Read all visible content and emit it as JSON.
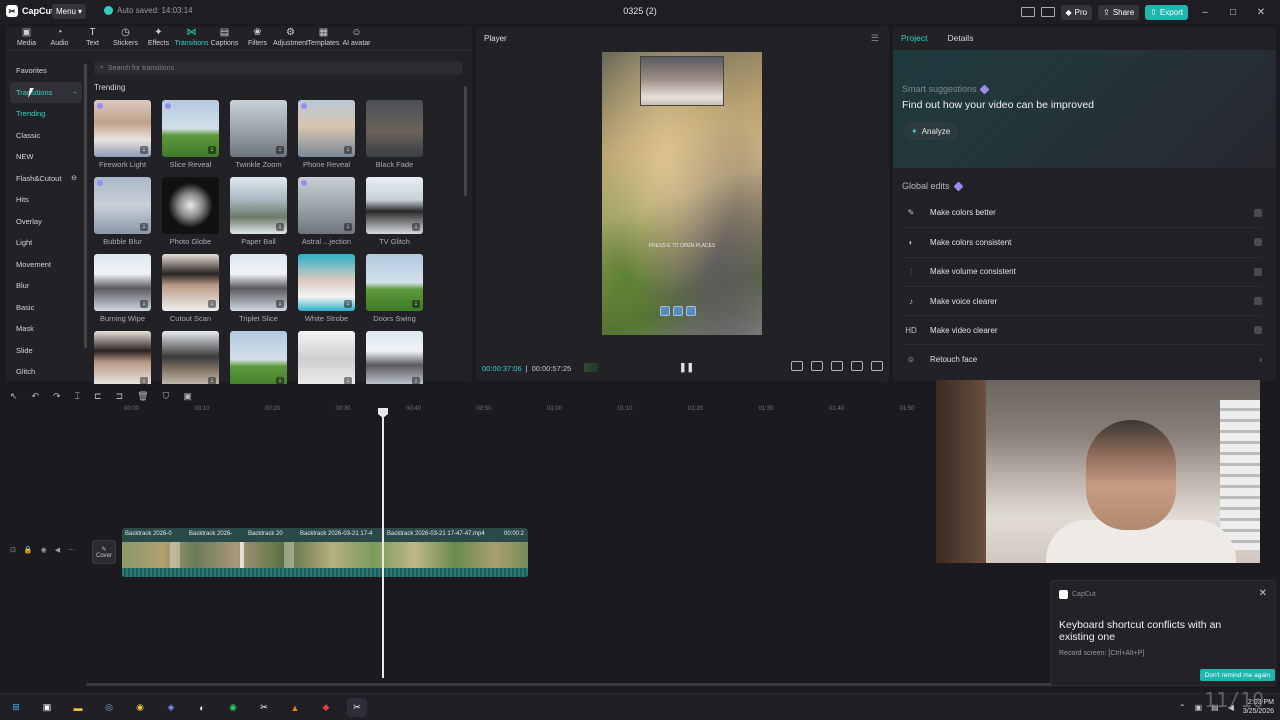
{
  "app": {
    "name": "CapCut",
    "menu": "Menu",
    "autosave": "Auto saved: 14:03:14",
    "project": "0325 (2)"
  },
  "titlebar": {
    "pro": "Pro",
    "share": "Share",
    "export": "Export"
  },
  "toolbar": [
    {
      "label": "Media",
      "icon": "media-icon",
      "glyph": "▣"
    },
    {
      "label": "Audio",
      "icon": "audio-icon",
      "glyph": "◔"
    },
    {
      "label": "Text",
      "icon": "text-icon",
      "glyph": "T"
    },
    {
      "label": "Stickers",
      "icon": "sticker-icon",
      "glyph": "◷"
    },
    {
      "label": "Effects",
      "icon": "effects-icon",
      "glyph": "✦"
    },
    {
      "label": "Transitions",
      "icon": "transitions-icon",
      "glyph": "⋈"
    },
    {
      "label": "Captions",
      "icon": "captions-icon",
      "glyph": "▤"
    },
    {
      "label": "Filters",
      "icon": "filters-icon",
      "glyph": "❀"
    },
    {
      "label": "Adjustment",
      "icon": "adjustment-icon",
      "glyph": "⚙"
    },
    {
      "label": "Templates",
      "icon": "templates-icon",
      "glyph": "▦"
    },
    {
      "label": "AI avatar",
      "icon": "ai-avatar-icon",
      "glyph": "☺"
    }
  ],
  "categories": [
    "Favorites",
    "Transitions",
    "Trending",
    "Classic",
    "NEW",
    "Flash&Cutout",
    "Hits",
    "Overlay",
    "Light",
    "Movement",
    "Blur",
    "Basic",
    "Mask",
    "Slide",
    "Glitch"
  ],
  "search": {
    "placeholder": "Search for transitions"
  },
  "section": "Trending",
  "transitions": [
    {
      "label": "Firework Light",
      "style": "t-portrait"
    },
    {
      "label": "Slice Reveal",
      "style": "t-table"
    },
    {
      "label": "Twinkle Zoom",
      "style": "t-car"
    },
    {
      "label": "Phone Reveal",
      "style": "t-tower"
    },
    {
      "label": "Black Fade",
      "style": "t-dark"
    },
    {
      "label": "Bubble Blur",
      "style": "t-blur"
    },
    {
      "label": "Photo Globe",
      "style": "t-globe"
    },
    {
      "label": "Paper Ball",
      "style": "t-paper"
    },
    {
      "label": "Astral ...jection",
      "style": "t-car"
    },
    {
      "label": "TV Glitch",
      "style": "t-man"
    },
    {
      "label": "Burning Wipe",
      "style": "t-snow"
    },
    {
      "label": "Cutout Scan",
      "style": "t-sunglass"
    },
    {
      "label": "Triplet Slice",
      "style": "t-snow"
    },
    {
      "label": "White Strobe",
      "style": "t-cyan"
    },
    {
      "label": "Doors Swing",
      "style": "t-table"
    },
    {
      "label": "",
      "style": "t-sunglass"
    },
    {
      "label": "",
      "style": "t-mono"
    },
    {
      "label": "",
      "style": "t-table"
    },
    {
      "label": "",
      "style": "t-faint"
    },
    {
      "label": "",
      "style": "t-snow"
    }
  ],
  "player": {
    "title": "Player",
    "current": "00:00:37:06",
    "duration": "00:00:57:25",
    "overlay_text": "PRESS E TO OPEN PLACES"
  },
  "rightpanel": {
    "tabs": [
      "Project",
      "Details"
    ],
    "smart_title": "Smart suggestions",
    "smart_desc": "Find out how your video can be improved",
    "analyze": "Analyze",
    "global_title": "Global edits",
    "edits": [
      {
        "label": "Make colors better",
        "icon": "magic-wand-icon",
        "glyph": "✎"
      },
      {
        "label": "Make colors consistent",
        "icon": "palette-icon",
        "glyph": "◐"
      },
      {
        "label": "Make volume consistent",
        "icon": "volume-bars-icon",
        "glyph": "⫶"
      },
      {
        "label": "Make voice clearer",
        "icon": "voice-icon",
        "glyph": "♪"
      },
      {
        "label": "Make video clearer",
        "icon": "hd-icon",
        "glyph": "HD"
      },
      {
        "label": "Retouch face",
        "icon": "face-icon",
        "glyph": "☺"
      }
    ]
  },
  "timeline": {
    "ticks": [
      "00:00",
      "00:10",
      "00:20",
      "00:30",
      "00:40",
      "00:50",
      "01:00",
      "01:10",
      "01:20",
      "01:30",
      "01:40",
      "01:50"
    ],
    "cover": "Cover",
    "clips": [
      {
        "label": "Backtrack 2026-0"
      },
      {
        "label": "Backtrack 2026-"
      },
      {
        "label": "Backtrack 20"
      },
      {
        "label": "Backtrack 2026-03-21 17-4"
      },
      {
        "label": "Backtrack 2026-03-21 17-47-47.mp4"
      },
      {
        "label": "00:00:2"
      }
    ]
  },
  "toast": {
    "app": "CapCut",
    "message": "Keyboard shortcut conflicts with an existing one",
    "shortcut": "Record screen: [Ctrl+Alt+P]",
    "button": "Don't remind me again"
  },
  "taskbar": {
    "time": "2:03 PM",
    "date": "3/25/2026",
    "overlay_time": "11/10"
  }
}
